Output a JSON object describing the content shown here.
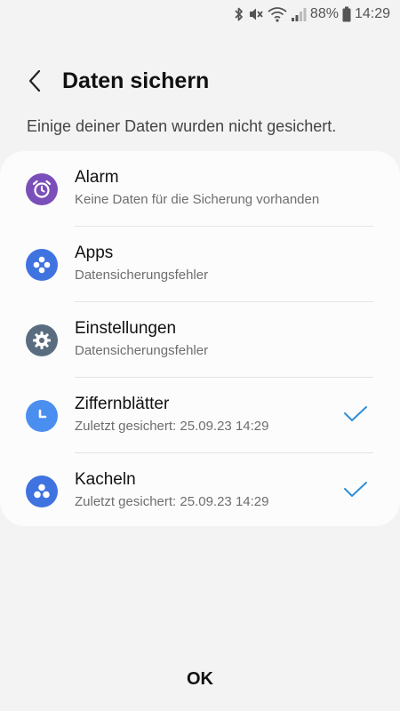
{
  "status_bar": {
    "battery_percent": "88%",
    "time": "14:29"
  },
  "header": {
    "title": "Daten sichern"
  },
  "subtitle": "Einige deiner Daten wurden nicht gesichert.",
  "items": [
    {
      "title": "Alarm",
      "subtitle": "Keine Daten für die Sicherung vorhanden",
      "icon": "alarm-clock-icon",
      "color": "#7b4fb9",
      "checked": false
    },
    {
      "title": "Apps",
      "subtitle": "Datensicherungsfehler",
      "icon": "apps-icon",
      "color": "#3f73e0",
      "checked": false
    },
    {
      "title": "Einstellungen",
      "subtitle": "Datensicherungsfehler",
      "icon": "gear-icon",
      "color": "#5a6d80",
      "checked": false
    },
    {
      "title": "Ziffernblätter",
      "subtitle": "Zuletzt gesichert: 25.09.23 14:29",
      "icon": "clock-face-icon",
      "color": "#4a8ef0",
      "checked": true
    },
    {
      "title": "Kacheln",
      "subtitle": "Zuletzt gesichert: 25.09.23 14:29",
      "icon": "tiles-icon",
      "color": "#3f73e0",
      "checked": true
    }
  ],
  "colors": {
    "background": "#f3f3f3",
    "card": "#fcfcfc",
    "check": "#2f8fd6"
  },
  "ok_label": "OK"
}
